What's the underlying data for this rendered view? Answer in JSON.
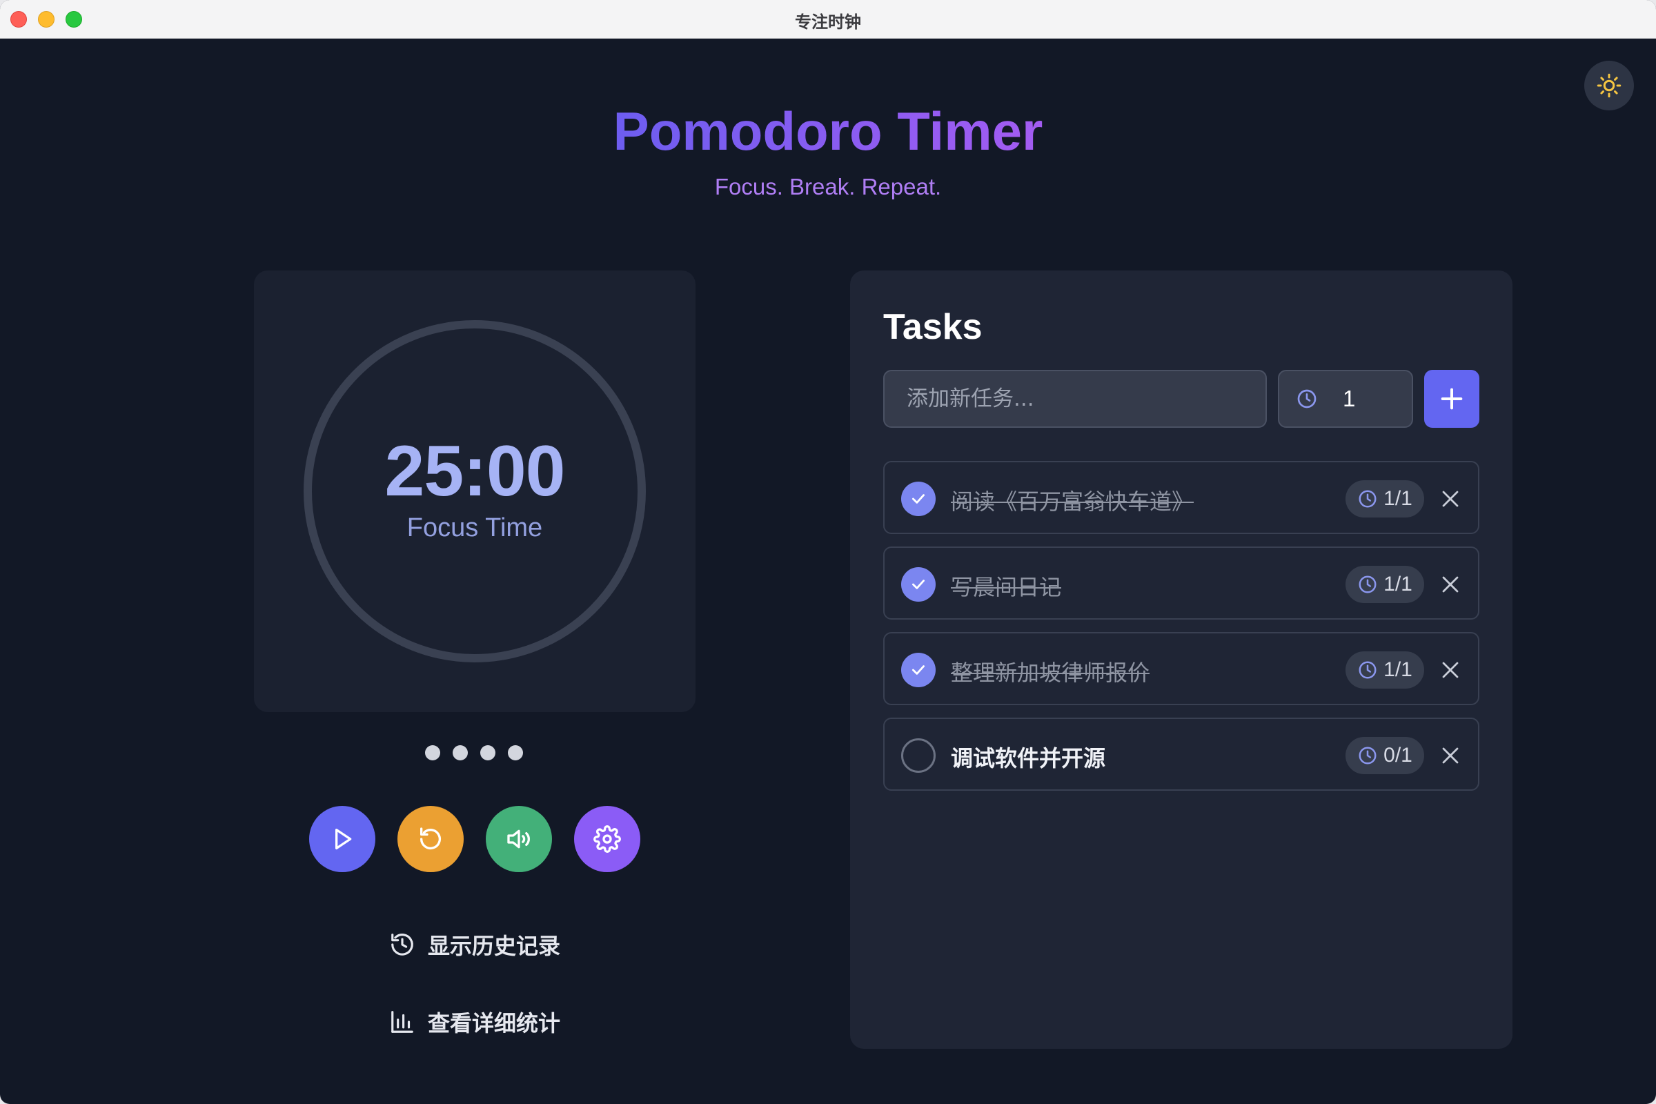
{
  "window": {
    "title": "专注时钟"
  },
  "header": {
    "title": "Pomodoro Timer",
    "subtitle": "Focus. Break. Repeat."
  },
  "theme_toggle": {
    "icon": "sun-icon",
    "color": "#f5c542"
  },
  "timer": {
    "time": "25:00",
    "mode": "Focus Time",
    "session_dots": 4
  },
  "controls": [
    {
      "name": "play",
      "icon": "play-icon",
      "color": "#6366f1"
    },
    {
      "name": "reset",
      "icon": "reset-icon",
      "color": "#eba032"
    },
    {
      "name": "sound",
      "icon": "volume-icon",
      "color": "#43b079"
    },
    {
      "name": "settings",
      "icon": "gear-icon",
      "color": "#8b5cf6"
    }
  ],
  "links": {
    "history": "显示历史记录",
    "stats": "查看详细统计"
  },
  "tasks": {
    "title": "Tasks",
    "input_placeholder": "添加新任务...",
    "pomodoro_count": "1",
    "items": [
      {
        "label": "阅读《百万富翁快车道》",
        "done": true,
        "progress": "1/1"
      },
      {
        "label": "写晨间日记",
        "done": true,
        "progress": "1/1"
      },
      {
        "label": "整理新加坡律师报价",
        "done": true,
        "progress": "1/1"
      },
      {
        "label": "调试软件并开源",
        "done": false,
        "progress": "0/1"
      }
    ]
  },
  "colors": {
    "background": "#121826",
    "card": "#1b2130",
    "accent": "#6366f1",
    "title_gradient_start": "#6d5df0",
    "title_gradient_end": "#a35cf2"
  }
}
